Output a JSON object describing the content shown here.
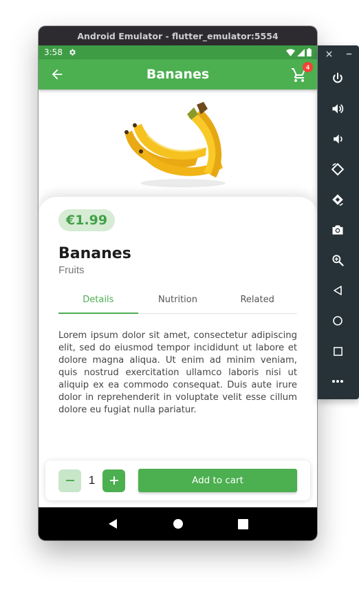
{
  "window": {
    "title": "Android Emulator - flutter_emulator:5554"
  },
  "status_bar": {
    "time": "3:58"
  },
  "app_bar": {
    "title": "Bananes",
    "cart_count": "4"
  },
  "product": {
    "price": "€1.99",
    "name": "Bananes",
    "category": "Fruits",
    "tabs": [
      {
        "label": "Details",
        "active": true
      },
      {
        "label": "Nutrition",
        "active": false
      },
      {
        "label": "Related",
        "active": false
      }
    ],
    "description": "Lorem ipsum dolor sit amet, consectetur adipiscing elit, sed do eiusmod tempor incididunt ut labore et dolore magna aliqua. Ut enim ad minim veniam, quis nostrud exercitation ullamco laboris nisi ut aliquip ex ea commodo consequat. Duis aute irure dolor in reprehenderit in voluptate velit esse cillum dolore eu fugiat nulla pariatur."
  },
  "cart_controls": {
    "quantity": "1",
    "add_label": "Add to cart"
  },
  "colors": {
    "primary": "#4caf50",
    "status_bar": "#3e9c45",
    "price_bg": "#d6ecd5",
    "badge": "#f44336",
    "side_toolbar": "#263238"
  },
  "icons": {
    "app_bar": [
      "arrow-back-icon",
      "shopping-cart-icon"
    ],
    "status_bar": [
      "settings-gear-icon",
      "wifi-icon",
      "signal-icon",
      "battery-icon"
    ],
    "nav_bar": [
      "nav-back-icon",
      "nav-home-icon",
      "nav-recents-icon"
    ],
    "side_toolbar": [
      "power-icon",
      "volume-up-icon",
      "volume-down-icon",
      "rotate-left-icon",
      "rotate-right-icon",
      "camera-icon",
      "zoom-icon",
      "back-icon",
      "home-icon",
      "overview-icon",
      "more-icon"
    ]
  }
}
